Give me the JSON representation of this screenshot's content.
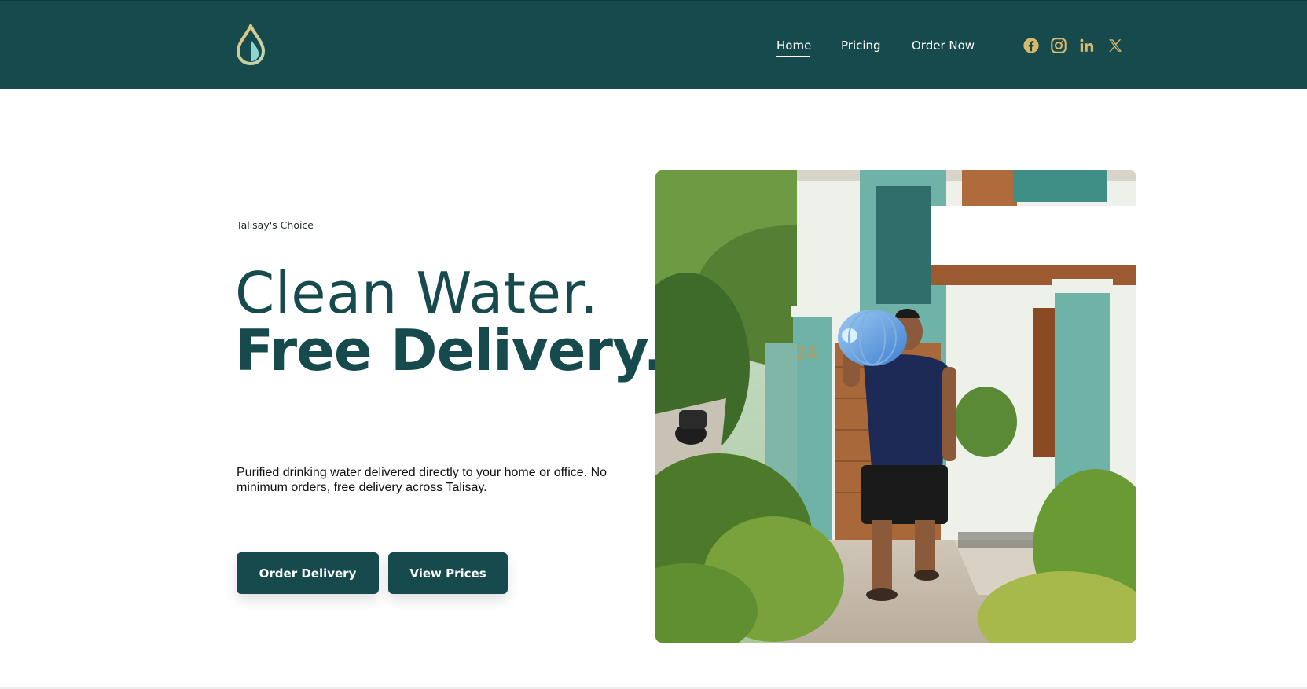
{
  "header": {
    "logo_icon": "water-drop-icon",
    "nav": [
      {
        "label": "Home",
        "active": true
      },
      {
        "label": "Pricing",
        "active": false
      },
      {
        "label": "Order Now",
        "active": false
      }
    ],
    "social": [
      "facebook-icon",
      "instagram-icon",
      "linkedin-icon",
      "x-icon"
    ]
  },
  "hero": {
    "tagline": "Talisay's Choice",
    "headline_line1": "Clean Water.",
    "headline_line2": "Free Delivery.",
    "description": "Purified drinking water delivered directly to your home or office. No minimum orders, free delivery across Talisay.",
    "primary_button": "Order Delivery",
    "secondary_button": "View Prices"
  },
  "colors": {
    "brand": "#174a4d",
    "accent_gold": "#d9b96a",
    "accent_aqua": "#8fd3d0",
    "background": "#ffffff"
  }
}
